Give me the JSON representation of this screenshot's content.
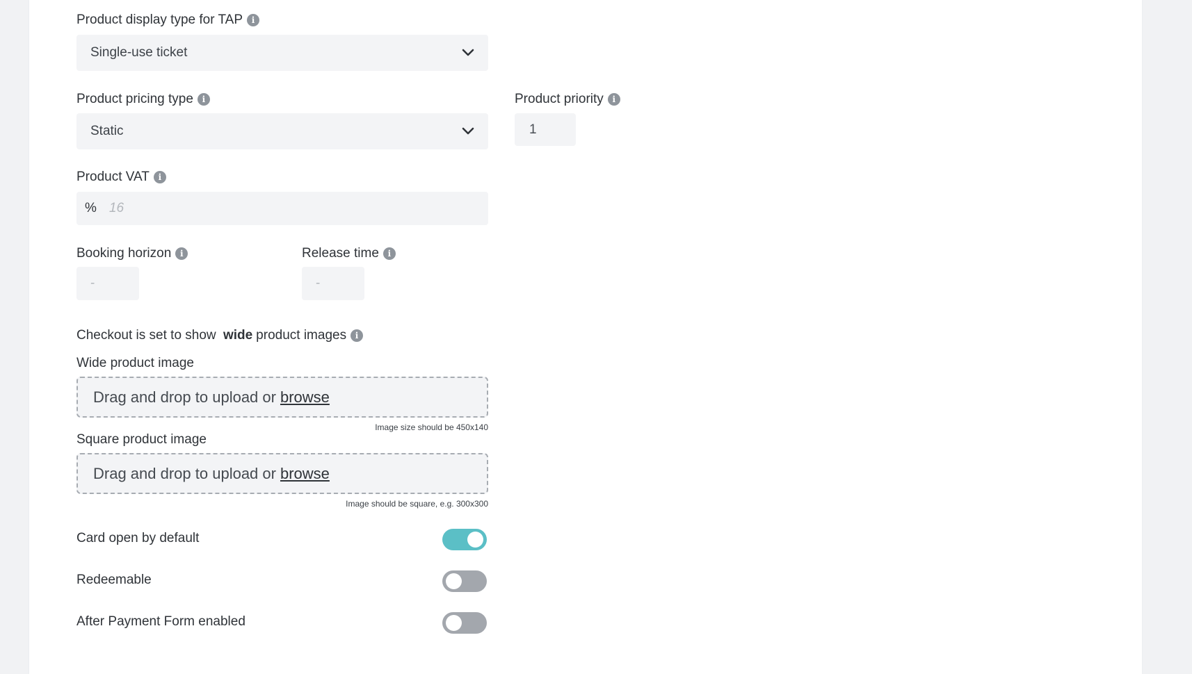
{
  "fields": {
    "display_type": {
      "label": "Product display type for TAP",
      "value": "Single-use ticket"
    },
    "pricing_type": {
      "label": "Product pricing type",
      "value": "Static"
    },
    "priority": {
      "label": "Product priority",
      "value": "1"
    },
    "vat": {
      "label": "Product VAT",
      "prefix": "%",
      "placeholder": "16"
    },
    "booking_horizon": {
      "label": "Booking horizon",
      "placeholder": "-"
    },
    "release_time": {
      "label": "Release time",
      "placeholder": "-"
    }
  },
  "checkout_note": {
    "prefix": "Checkout is set to show ",
    "bold": "wide",
    "suffix": " product images"
  },
  "wide_image": {
    "label": "Wide product image",
    "drop_text": "Drag and drop to upload or",
    "browse": "browse",
    "hint": "Image size should be 450x140"
  },
  "square_image": {
    "label": "Square product image",
    "drop_text": "Drag and drop to upload or",
    "browse": "browse",
    "hint": "Image should be square, e.g. 300x300"
  },
  "toggles": [
    {
      "label": "Card open by default",
      "state": "on"
    },
    {
      "label": "Redeemable",
      "state": "off"
    },
    {
      "label": "After Payment Form enabled",
      "state": "off"
    }
  ],
  "icons": [
    "info-icon",
    "chevron-down-icon"
  ],
  "colors": {
    "toggle_on": "#5bbfc6",
    "toggle_off": "#a3a7ad",
    "input_bg": "#f3f4f6"
  }
}
